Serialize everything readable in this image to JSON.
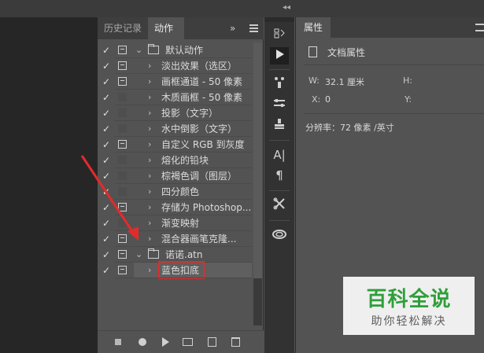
{
  "history_tab": "历史记录",
  "actions_tab": "动作",
  "expand_glyph": "»",
  "top_collapse_glyph": "◂◂",
  "actions": [
    {
      "checked": true,
      "dialog": true,
      "arrow": "⌄",
      "folder": true,
      "label": "默认动作",
      "indent": "set"
    },
    {
      "checked": true,
      "dialog": true,
      "arrow": "›",
      "label": "淡出效果（选区）"
    },
    {
      "checked": true,
      "dialog": true,
      "arrow": "›",
      "label": "画框通道 - 50 像素"
    },
    {
      "checked": true,
      "dialog": false,
      "arrow": "›",
      "label": "木质画框 - 50 像素"
    },
    {
      "checked": true,
      "dialog": false,
      "arrow": "›",
      "label": "投影（文字）"
    },
    {
      "checked": true,
      "dialog": false,
      "arrow": "›",
      "label": "水中倒影（文字）"
    },
    {
      "checked": true,
      "dialog": true,
      "arrow": "›",
      "label": "自定义 RGB 到灰度"
    },
    {
      "checked": true,
      "dialog": false,
      "arrow": "›",
      "label": "熔化的铅块"
    },
    {
      "checked": true,
      "dialog": false,
      "arrow": "›",
      "label": "棕褐色调（图层）"
    },
    {
      "checked": true,
      "dialog": false,
      "arrow": "›",
      "label": "四分颜色"
    },
    {
      "checked": true,
      "dialog": true,
      "arrow": "›",
      "label": "存储为 Photoshop..."
    },
    {
      "checked": true,
      "dialog": false,
      "arrow": "›",
      "label": "渐变映射"
    },
    {
      "checked": true,
      "dialog": true,
      "arrow": "›",
      "label": "混合器画笔克隆..."
    },
    {
      "checked": true,
      "dialog": true,
      "arrow": "⌄",
      "folder": true,
      "label": "诺诺.atn",
      "indent": "set"
    },
    {
      "checked": true,
      "dialog": true,
      "arrow": "›",
      "label": "蓝色扣底",
      "selected": true
    }
  ],
  "properties": {
    "tab": "属性",
    "doc_title": "文档属性",
    "w_label": "W:",
    "w_value": "32.1 厘米",
    "h_label": "H:",
    "x_label": "X:",
    "x_value": "0",
    "y_label": "Y:",
    "resolution": "分辨率：72 像素 /英寸"
  },
  "tools": {
    "history_icon": "history-brush-icon",
    "play_icon": "play-icon",
    "brush_icon": "brush-presets-icon",
    "adjust_icon": "adjustments-icon",
    "stamp_icon": "clone-source-icon",
    "type_icon": "character-icon",
    "para_icon": "paragraph-icon",
    "tools_icon": "tool-presets-icon",
    "cc_icon": "creative-cloud-icon",
    "type_glyph": "A|",
    "para_glyph": "¶"
  },
  "watermark": {
    "title": "百科全说",
    "subtitle": "助你轻松解决"
  },
  "colors": {
    "highlight_red": "#e22b2b",
    "watermark_green": "#2f9f3a"
  }
}
